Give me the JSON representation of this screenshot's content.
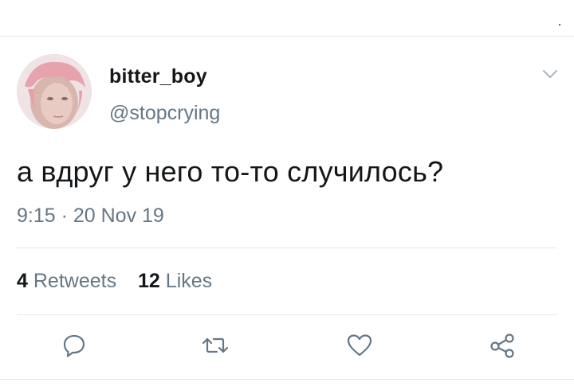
{
  "tweet": {
    "display_name": "bitter_boy",
    "handle": "@stopcrying",
    "text": "а вдруг у него то-то случилось?",
    "timestamp": "9:15 · 20 Nov 19"
  },
  "stats": {
    "retweets_count": "4",
    "retweets_label": "Retweets",
    "likes_count": "12",
    "likes_label": "Likes"
  },
  "icons": {
    "menu": "chevron-down-icon",
    "reply": "reply-icon",
    "retweet": "retweet-icon",
    "like": "heart-icon",
    "share": "share-icon"
  },
  "colors": {
    "primary_text": "#14171a",
    "secondary_text": "#657786",
    "divider": "#e1e8ed",
    "avatar_hair": "#e8a6b0"
  }
}
